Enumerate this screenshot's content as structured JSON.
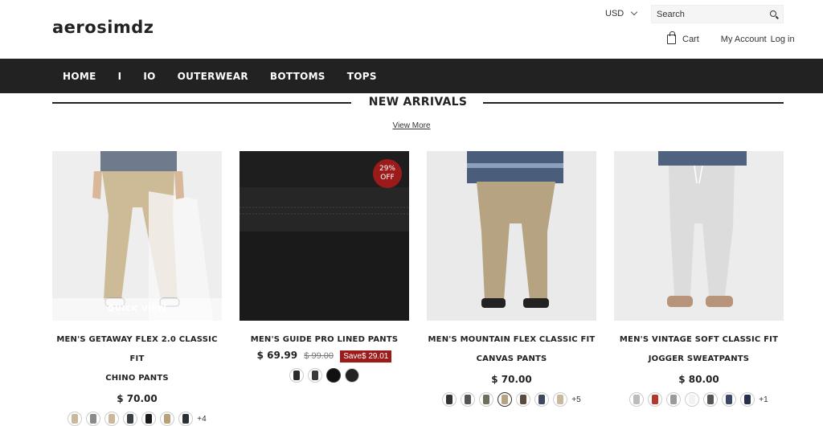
{
  "brand": {
    "logo": "aerosimdz"
  },
  "header": {
    "currency": "USD",
    "search_placeholder": "Search",
    "cart_label": "Cart",
    "my_account_label": "My Account",
    "login_label": "Log in"
  },
  "nav": {
    "items": [
      "HOME",
      "I",
      "IO",
      "OUTERWEAR",
      "BOTTOMS",
      "TOPS"
    ]
  },
  "section": {
    "title": "NEW ARRIVALS",
    "view_more": "View More"
  },
  "products": [
    {
      "name1": "MEN'S GETAWAY FLEX 2.0 CLASSIC FIT",
      "name2": "CHINO PANTS",
      "price": "$ 70.00",
      "quick_view": "QUICK VIEW",
      "more": "+4"
    },
    {
      "name1": "MEN'S GUIDE PRO LINED PANTS",
      "price": "$ 69.99",
      "old_price": "$ 99.00",
      "save": "Save$ 29.01",
      "badge_pct": "29%",
      "badge_off": "OFF"
    },
    {
      "name1": "MEN'S MOUNTAIN FLEX CLASSIC FIT",
      "name2": "CANVAS PANTS",
      "price": "$ 70.00",
      "more": "+5"
    },
    {
      "name1": "MEN'S VINTAGE SOFT CLASSIC FIT",
      "name2": "JOGGER SWEATPANTS",
      "price": "$ 80.00",
      "more": "+1"
    }
  ],
  "colors": {
    "nav_bg": "#222222",
    "sale_red": "#9b1b1b",
    "khaki": "#c9b89a",
    "black": "#1a1a1a",
    "heather_grey": "#d9d9d9"
  }
}
